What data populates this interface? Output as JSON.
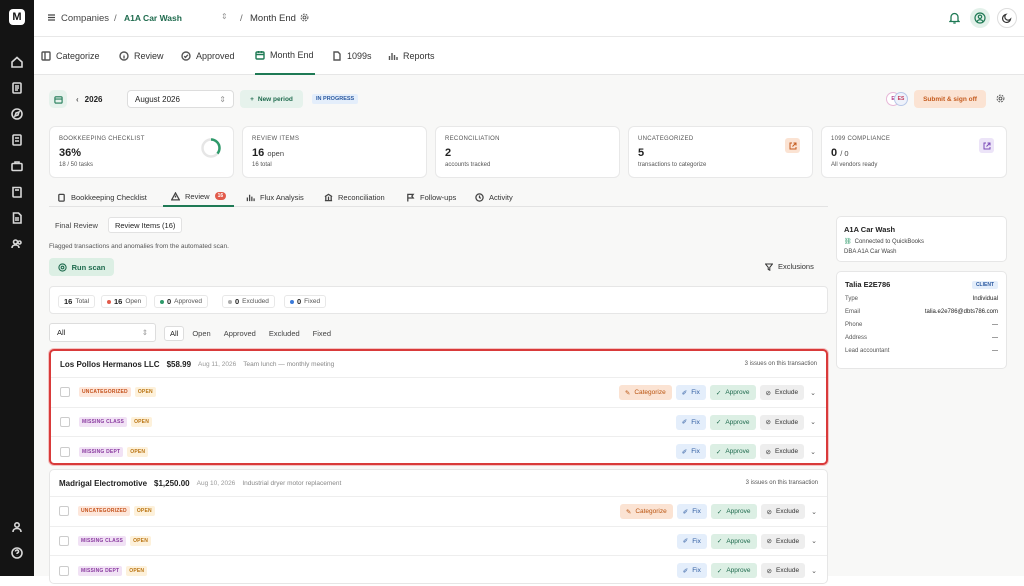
{
  "topbar": {
    "companies": "Companies",
    "sep1": "/",
    "company": "A1A Car Wash",
    "sep2": "/",
    "page": "Month End"
  },
  "nav_tabs": [
    "Categorize",
    "Review",
    "Approved",
    "Month End",
    "1099s",
    "Reports"
  ],
  "period": {
    "year": "2026",
    "month": "August 2026",
    "new_period": "New period",
    "status": "IN PROGRESS",
    "avatar1": "E",
    "avatar2": "ES",
    "signoff": "Submit & sign off"
  },
  "cards": {
    "checklist": {
      "label": "BOOKKEEPING CHECKLIST",
      "value": "36%",
      "sub": "18 / 50 tasks",
      "progress": 0.36
    },
    "review": {
      "label": "REVIEW ITEMS",
      "value": "16",
      "unit": "open",
      "sub": "16 total"
    },
    "recon": {
      "label": "RECONCILIATION",
      "value": "2",
      "sub": "accounts tracked"
    },
    "uncat": {
      "label": "UNCATEGORIZED",
      "value": "5",
      "sub": "transactions to categorize"
    },
    "compliance": {
      "label": "1099 COMPLIANCE",
      "value": "0",
      "unit": "/ 0",
      "sub": "All vendors ready"
    }
  },
  "sub_tabs": {
    "checklist": "Bookkeeping Checklist",
    "review": "Review",
    "review_count": "16",
    "flux": "Flux Analysis",
    "recon": "Reconciliation",
    "followups": "Follow-ups",
    "activity": "Activity"
  },
  "review_tabs": {
    "final": "Final Review",
    "items": "Review Items (16)"
  },
  "description": "Flagged transactions and anomalies from the automated scan.",
  "run_scan": "Run scan",
  "exclusions": "Exclusions",
  "stats": {
    "total_n": "16",
    "total_l": "Total",
    "open_n": "16",
    "open_l": "Open",
    "approved_n": "0",
    "approved_l": "Approved",
    "excluded_n": "0",
    "excluded_l": "Excluded",
    "fixed_n": "0",
    "fixed_l": "Fixed"
  },
  "filter": {
    "select": "All",
    "chips": [
      "All",
      "Open",
      "Approved",
      "Excluded",
      "Fixed"
    ]
  },
  "actions": {
    "categorize": "Categorize",
    "fix": "Fix",
    "approve": "Approve",
    "exclude": "Exclude"
  },
  "groups": [
    {
      "vendor": "Los Pollos Hermanos LLC",
      "amount": "$58.99",
      "date": "Aug 11, 2026",
      "memo": "Team lunch — monthly meeting",
      "issues": "3 issues on this transaction",
      "rows": [
        {
          "tag": "UNCATEGORIZED",
          "status": "OPEN"
        },
        {
          "tag": "MISSING CLASS",
          "status": "OPEN"
        },
        {
          "tag": "MISSING DEPT",
          "status": "OPEN"
        }
      ]
    },
    {
      "vendor": "Madrigal Electromotive",
      "amount": "$1,250.00",
      "date": "Aug 10, 2026",
      "memo": "Industrial dryer motor replacement",
      "issues": "3 issues on this transaction",
      "rows": [
        {
          "tag": "UNCATEGORIZED",
          "status": "OPEN"
        },
        {
          "tag": "MISSING CLASS",
          "status": "OPEN"
        },
        {
          "tag": "MISSING DEPT",
          "status": "OPEN"
        }
      ]
    }
  ],
  "company_card": {
    "name": "A1A Car Wash",
    "connected": "Connected to QuickBooks",
    "dba": "DBA A1A Car Wash"
  },
  "client_card": {
    "name": "Talia E2E786",
    "badge": "CLIENT",
    "type_l": "Type",
    "type_v": "Individual",
    "email_l": "Email",
    "email_v": "talia.e2e786@dbts786.com",
    "phone_l": "Phone",
    "phone_v": "—",
    "address_l": "Address",
    "address_v": "—",
    "lead_l": "Lead accountant",
    "lead_v": "—"
  },
  "colors": {
    "accent": "#1f7a55",
    "highlight": "#d93a3a"
  }
}
